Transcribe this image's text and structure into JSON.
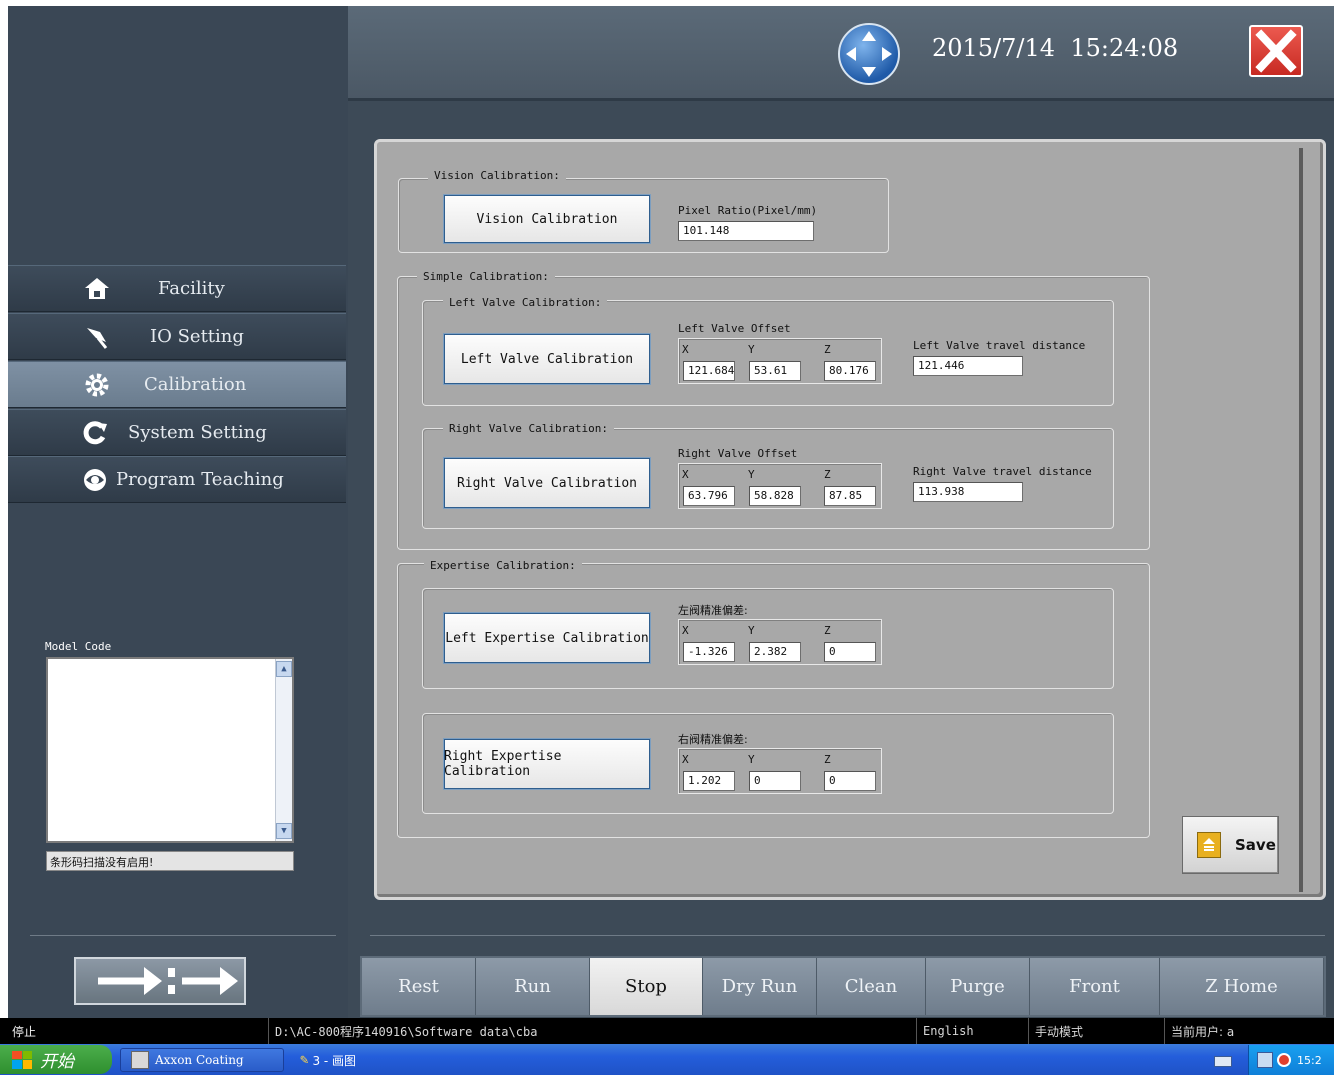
{
  "header": {
    "datetime": "2015/7/14  15:24:08"
  },
  "sidebar": {
    "items": [
      {
        "label": "Facility",
        "icon": "home-icon"
      },
      {
        "label": "IO Setting",
        "icon": "pin-icon"
      },
      {
        "label": "Calibration",
        "icon": "gear-icon"
      },
      {
        "label": "System Setting",
        "icon": "refresh-icon"
      },
      {
        "label": "Program Teaching",
        "icon": "eye-icon"
      }
    ],
    "active": "Calibration",
    "model_code_label": "Model Code",
    "barcode_status": "条形码扫描没有启用!"
  },
  "vision": {
    "group_title": "Vision Calibration:",
    "button": "Vision Calibration",
    "ratio_label": "Pixel Ratio(Pixel/mm)",
    "ratio_value": "101.148"
  },
  "simple": {
    "group_title": "Simple Calibration:",
    "left": {
      "group_title": "Left Valve Calibration:",
      "button": "Left Valve Calibration",
      "offset_label": "Left Valve Offset",
      "x": "121.684",
      "y": "53.61",
      "z": "80.176",
      "travel_label": "Left Valve travel distance",
      "travel_value": "121.446"
    },
    "right": {
      "group_title": "Right Valve Calibration:",
      "button": "Right Valve Calibration",
      "offset_label": "Right Valve Offset",
      "x": "63.796",
      "y": "58.828",
      "z": "87.85",
      "travel_label": "Right Valve travel distance",
      "travel_value": "113.938"
    }
  },
  "expertise": {
    "group_title": "Expertise Calibration:",
    "left": {
      "button": "Left Expertise Calibration",
      "offset_label": "左阀精准偏差:",
      "x": "-1.326",
      "y": "2.382",
      "z": "0"
    },
    "right": {
      "button": "Right Expertise Calibration",
      "offset_label": "右阀精准偏差:",
      "x": "1.202",
      "y": "0",
      "z": "0"
    }
  },
  "axis_labels": {
    "x": "X",
    "y": "Y",
    "z": "Z"
  },
  "save_button": "Save",
  "bottom_buttons": [
    "Rest",
    "Run",
    "Stop",
    "Dry Run",
    "Clean",
    "Purge",
    "Front",
    "Z Home"
  ],
  "active_bottom": "Stop",
  "status": {
    "state": "停止",
    "path": "D:\\AC-800程序140916\\Software data\\cba",
    "language": "English",
    "mode": "手动模式",
    "user": "当前用户: a"
  },
  "taskbar": {
    "start": "开始",
    "tasks": [
      "Axxon Coating",
      "3 - 画图"
    ],
    "clock": "15:2"
  },
  "colors": {
    "accent": "#245edb",
    "close_red": "#d9342b",
    "panel_bg": "#a8a8a8"
  }
}
